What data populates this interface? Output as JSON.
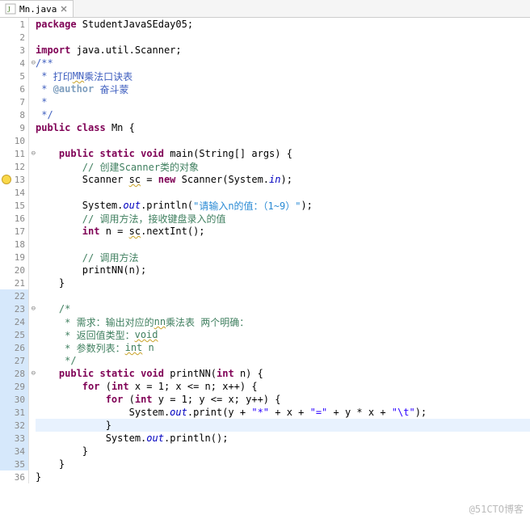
{
  "tab": {
    "filename": "Mn.java"
  },
  "watermark": "@51CTO博客",
  "code": {
    "package_kw": "package",
    "package_name": " StudentJavaSEday05;",
    "import_kw": "import",
    "import_name": " java.util.Scanner;",
    "jd_open": "/**",
    "jd_star": " * ",
    "jd_line1_a": "打印",
    "jd_line1_b": "MN",
    "jd_line1_c": "乘法口诀表",
    "jd_author_tag": "@author",
    "jd_author_val": " 奋斗蒙",
    "jd_star2": " *",
    "jd_close": " */",
    "public_kw": "public",
    "class_kw": "class",
    "class_name": " Mn {",
    "static_kw": "static",
    "void_kw": "void",
    "main_sig": " main(String[] args) {",
    "c12": "// 创建Scanner类的对象",
    "l13a": "Scanner ",
    "l13b": "sc",
    "l13c": " = ",
    "new_kw": "new",
    "l13d": " Scanner(System.",
    "l13e": "in",
    "l13f": ");",
    "l15a": "System.",
    "out": "out",
    "l15b": ".println(",
    "l15str1": "\"请输入n的值：（1~9）\"",
    "l15c": ");",
    "c16": "// 调用方法，接收键盘录入的值",
    "int_kw": "int",
    "l17a": " n = ",
    "l17b": "sc",
    "l17c": ".nextInt();",
    "c19": "// 调用方法",
    "l20": "printNN(n);",
    "rb": "}",
    "c23": "/*",
    "c24a": " * 需求：输出对应的",
    "c24b": "nn",
    "c24c": "乘法表 两个明确：",
    "c25a": " * 返回值类型：",
    "c25b": "void",
    "c26a": " * 参数列表：",
    "c26b": "int",
    "c26c": " n",
    "c27": " */",
    "l28a": " printNN(",
    "l28b": " n) {",
    "for_kw": "for",
    "l29a": " (",
    "l29b": " x = 1; x <= n; x++) {",
    "l30a": " (",
    "l30b": " y = 1; y <= x; y++) {",
    "l31a": "System.",
    "l31b": ".print(y + ",
    "l31s1": "\"*\"",
    "l31c": " + x + ",
    "l31s2": "\"=\"",
    "l31d": " + y * x + ",
    "l31s3": "\"\\t\"",
    "l31e": ");",
    "l33a": "System.",
    "l33b": ".println();"
  },
  "line_numbers": [
    "1",
    "2",
    "3",
    "4",
    "5",
    "6",
    "7",
    "8",
    "9",
    "10",
    "11",
    "12",
    "13",
    "14",
    "15",
    "16",
    "17",
    "18",
    "19",
    "20",
    "21",
    "22",
    "23",
    "24",
    "25",
    "26",
    "27",
    "28",
    "29",
    "30",
    "31",
    "32",
    "33",
    "34",
    "35",
    "36"
  ]
}
